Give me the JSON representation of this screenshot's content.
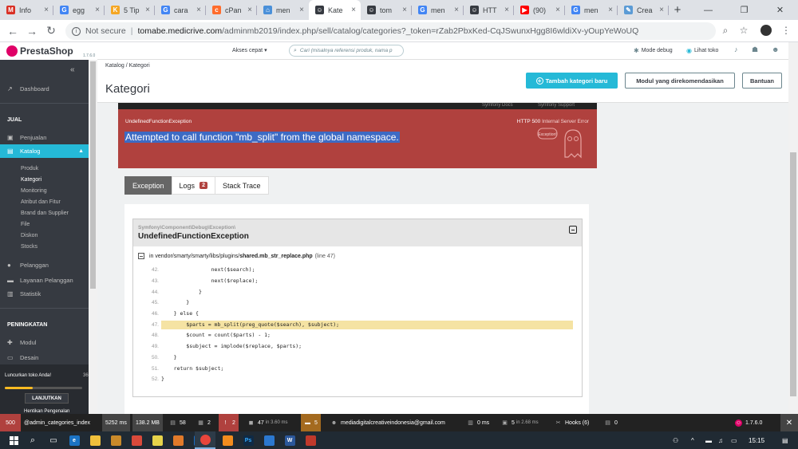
{
  "browser": {
    "tabs": [
      {
        "label": "Info",
        "icon": "gmail-icon",
        "color": "#d93025",
        "glyph": "M"
      },
      {
        "label": "egg",
        "icon": "google-icon",
        "color": "#4285f4",
        "glyph": "G"
      },
      {
        "label": "5 Tip",
        "icon": "k-icon",
        "color": "#f5a623",
        "glyph": "K"
      },
      {
        "label": "cara",
        "icon": "google-icon",
        "color": "#4285f4",
        "glyph": "G"
      },
      {
        "label": "cPan",
        "icon": "cpanel-icon",
        "color": "#ff6c2c",
        "glyph": "c"
      },
      {
        "label": "men",
        "icon": "home-icon",
        "color": "#4a90d9",
        "glyph": "⌂"
      },
      {
        "label": "Kate",
        "icon": "prestashop-icon",
        "color": "#363a41",
        "glyph": "☺"
      },
      {
        "label": "tom",
        "icon": "prestashop-icon",
        "color": "#363a41",
        "glyph": "☺"
      },
      {
        "label": "men",
        "icon": "google-icon",
        "color": "#4285f4",
        "glyph": "G"
      },
      {
        "label": "HTT",
        "icon": "prestashop-icon",
        "color": "#363a41",
        "glyph": "☺"
      },
      {
        "label": "(90)",
        "icon": "youtube-icon",
        "color": "#ff0000",
        "glyph": "▶"
      },
      {
        "label": "men",
        "icon": "google-icon",
        "color": "#4285f4",
        "glyph": "G"
      },
      {
        "label": "Crea",
        "icon": "blogger-icon",
        "color": "#5b9bd5",
        "glyph": "✎"
      }
    ],
    "active_tab": 6,
    "new_tab": "+",
    "window_minimize": "—",
    "window_restore": "❐",
    "window_close": "✕",
    "not_secure": "Not secure",
    "url_host": "tomabe.medicrive.com",
    "url_path": "/adminmb2019/index.php/sell/catalog/categories?_token=rZab2PbxKed-CqJSwunxHgg8I6wldiXv-yOupYeWoUQ"
  },
  "sidebar": {
    "brand": "PrestaShop",
    "version": "1.7.6.0",
    "collapse_label": "«",
    "dashboard": "Dashboard",
    "section_jual": "JUAL",
    "penjualan": "Penjualan",
    "katalog": "Katalog",
    "katalog_sub": [
      "Produk",
      "Kategori",
      "Monitoring",
      "Atribut dan Fitur",
      "Brand dan Supplier",
      "File",
      "Diskon",
      "Stocks"
    ],
    "current_sub": "Kategori",
    "pelanggan": "Pelanggan",
    "layanan": "Layanan Pelanggan",
    "statistik": "Statistik",
    "section_peningkatan": "PENINGKATAN",
    "modul": "Modul",
    "desain": "Desain",
    "promo_text": "Luncurkan toko Anda!",
    "promo_pct": "36",
    "promo_progress": 0.36,
    "promo_button": "LANJUTKAN",
    "promo_more": "Hentikan Pengenalan"
  },
  "header": {
    "quick_access": "Akses cepat",
    "search_placeholder": "Cari (misalnya referensi produk, nama p",
    "mode_debug": "Mode debug",
    "lihat_toko": "Lihat toko"
  },
  "page": {
    "breadcrumb_1": "Katalog",
    "breadcrumb_sep": "/",
    "breadcrumb_2": "Kategori",
    "title": "Kategori",
    "btn_add": "Tambah kategori baru",
    "btn_modules": "Modul yang direkomendasikan",
    "btn_help": "Bantuan"
  },
  "error": {
    "top_link_1": "Symfony Docs",
    "top_link_2": "Symfony Support",
    "exception_class": "UndefinedFunctionException",
    "http_code": "HTTP 500",
    "http_text": "Internal Server Error",
    "message": "Attempted to call function \"mb_split\" from the global namespace.",
    "ghost_label": "Exception!",
    "tabs": {
      "exception": "Exception",
      "logs": "Logs",
      "logs_count": "2",
      "stack_trace": "Stack Trace"
    },
    "namespace": "Symfony\\Component\\Debug\\Exception\\",
    "name": "UndefinedFunctionException",
    "file_prefix": "in vendor/smarty/smarty/libs/plugins/",
    "file_name": "shared.mb_str_replace.php",
    "file_line": "(line 47)",
    "code_lines": [
      {
        "n": "42.",
        "code": "                next($search);",
        "hl": false
      },
      {
        "n": "43.",
        "code": "                next($replace);",
        "hl": false
      },
      {
        "n": "44.",
        "code": "            }",
        "hl": false
      },
      {
        "n": "45.",
        "code": "        }",
        "hl": false
      },
      {
        "n": "46.",
        "code": "    } else {",
        "hl": false
      },
      {
        "n": "47.",
        "code": "        $parts = mb_split(preg_quote($search), $subject);",
        "hl": true
      },
      {
        "n": "48.",
        "code": "        $count = count($parts) - 1;",
        "hl": false
      },
      {
        "n": "49.",
        "code": "        $subject = implode($replace, $parts);",
        "hl": false
      },
      {
        "n": "50.",
        "code": "    }",
        "hl": false
      },
      {
        "n": "51.",
        "code": "    return $subject;",
        "hl": false
      },
      {
        "n": "52.",
        "code": "}",
        "hl": false
      }
    ]
  },
  "debugbar": {
    "status": "500",
    "route": "@admin_categories_index",
    "time": "5252 ms",
    "memory": "138.2 MB",
    "forms": "58",
    "requests": "2",
    "errors": "2",
    "db_queries": "47",
    "db_time": "in 3.60 ms",
    "security": "5",
    "user": "mediadigitalcreativeindonesia@gmail.com",
    "cache_time": "0 ms",
    "twig": "5",
    "twig_time": "in 2.68 ms",
    "hooks": "Hooks (6)",
    "modules": "0",
    "version": "1.7.6.0",
    "close": "✕"
  },
  "taskbar": {
    "time": "15:15"
  }
}
